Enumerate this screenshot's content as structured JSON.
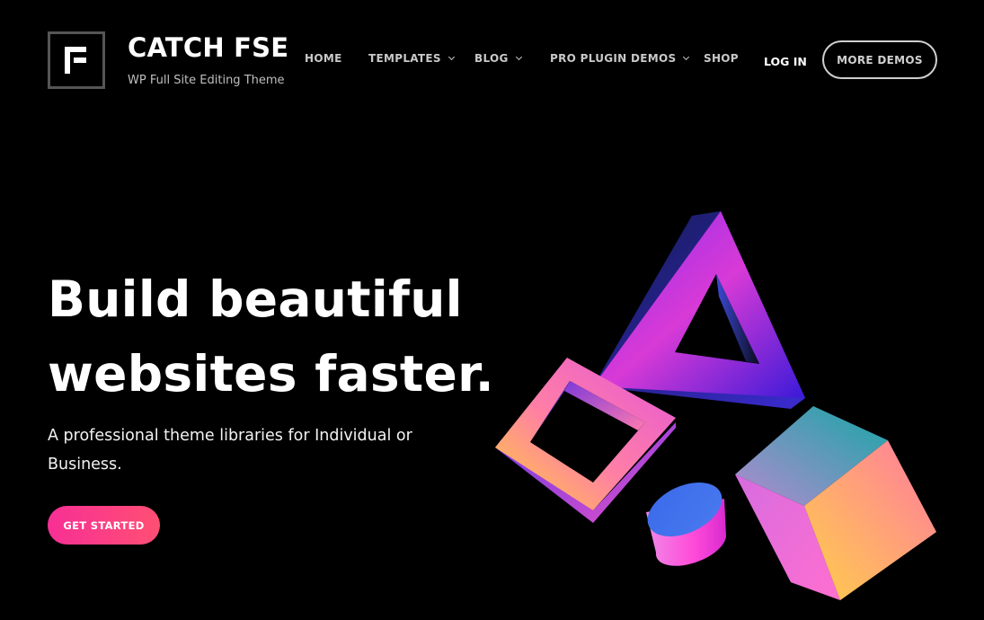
{
  "site": {
    "title": "CATCH FSE",
    "tagline": "WP Full Site Editing Theme",
    "logo_icon": "f-letter-logo"
  },
  "nav": {
    "items": [
      {
        "label": "HOME",
        "has_dropdown": false
      },
      {
        "label": "TEMPLATES",
        "has_dropdown": true
      },
      {
        "label": "BLOG",
        "has_dropdown": true
      },
      {
        "label": "PRO PLUGIN DEMOS",
        "has_dropdown": true
      },
      {
        "label": "SHOP",
        "has_dropdown": false
      }
    ],
    "login_label": "LOG IN",
    "more_demos_label": "MORE DEMOS"
  },
  "hero": {
    "title_line1": "Build beautiful",
    "title_line2": "websites faster.",
    "subtitle": "A professional theme libraries for Individual or Business.",
    "cta_label": "GET STARTED"
  },
  "colors": {
    "background": "#000000",
    "cta_start": "#f72f95",
    "cta_end": "#ff4f73",
    "nav_text": "#c9c9c9"
  }
}
